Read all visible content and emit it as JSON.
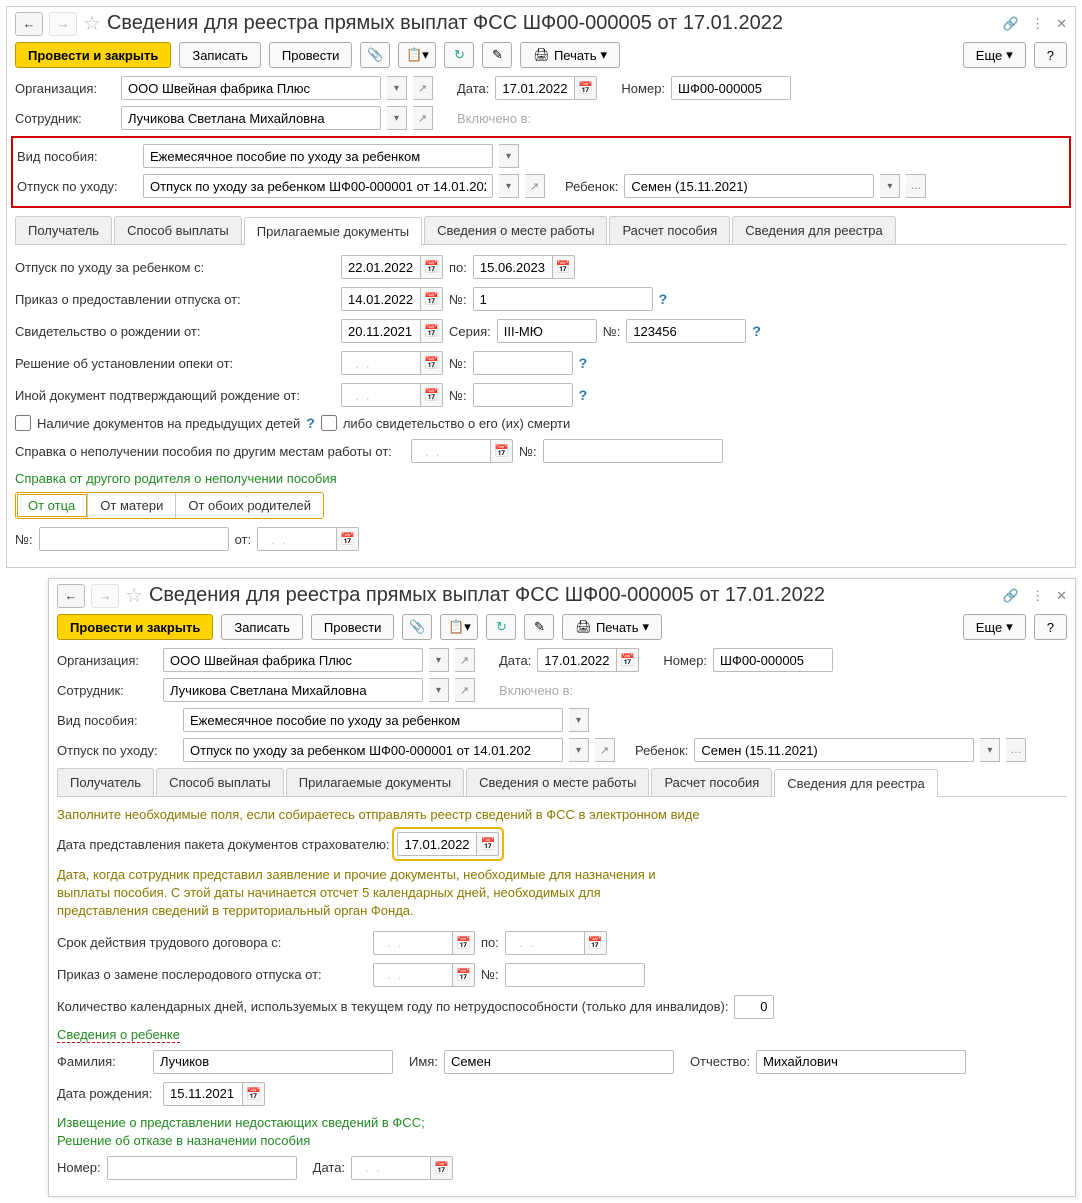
{
  "win1": {
    "title": "Сведения для реестра прямых выплат ФСС ШФ00-000005 от 17.01.2022",
    "toolbar": {
      "submit": "Провести и закрыть",
      "write": "Записать",
      "post": "Провести",
      "print": "Печать",
      "more": "Еще",
      "help": "?"
    },
    "org": {
      "label": "Организация:",
      "value": "ООО Швейная фабрика Плюс"
    },
    "date": {
      "label": "Дата:",
      "value": "17.01.2022"
    },
    "number": {
      "label": "Номер:",
      "value": "ШФ00-000005"
    },
    "emp": {
      "label": "Сотрудник:",
      "value": "Лучикова Светлана Михайловна"
    },
    "included": {
      "label": "Включено в:"
    },
    "benefit": {
      "label": "Вид пособия:",
      "value": "Ежемесячное пособие по уходу за ребенком"
    },
    "leave": {
      "label": "Отпуск по уходу:",
      "value": "Отпуск по уходу за ребенком ШФ00-000001 от 14.01.202"
    },
    "child": {
      "label": "Ребенок:",
      "value": "Семен (15.11.2021)"
    },
    "tabs": [
      "Получатель",
      "Способ выплаты",
      "Прилагаемые документы",
      "Сведения о месте работы",
      "Расчет пособия",
      "Сведения для реестра"
    ],
    "f": {
      "leaveFrom": {
        "label": "Отпуск по уходу за ребенком с:",
        "v1": "22.01.2022",
        "to": "по:",
        "v2": "15.06.2023"
      },
      "order": {
        "label": "Приказ о предоставлении отпуска от:",
        "date": "14.01.2022",
        "no": "№:",
        "nov": "1"
      },
      "birth": {
        "label": "Свидетельство о рождении от:",
        "date": "20.11.2021",
        "series": "Серия:",
        "sv": "III-МЮ",
        "no": "№:",
        "nov": "123456"
      },
      "guard": {
        "label": "Решение об установлении опеки от:",
        "date": "  .  .    ",
        "no": "№:"
      },
      "other": {
        "label": "Иной документ подтверждающий рождение от:",
        "date": "  .  .    ",
        "no": "№:"
      },
      "prev": {
        "label": "Наличие документов на предыдущих детей",
        "death": "либо свидетельство о его (их) смерти"
      },
      "spravka": {
        "label": "Справка о неполучении пособия по другим местам работы от:",
        "date": "  .  .    ",
        "no": "№:"
      },
      "parent": {
        "title": "Справка от другого родителя о неполучении пособия",
        "opts": [
          "От отца",
          "От матери",
          "От обоих родителей"
        ]
      },
      "bottom": {
        "no": "№:",
        "from": "от:",
        "date": "  .  .    "
      }
    }
  },
  "win2": {
    "title": "Сведения для реестра прямых выплат ФСС ШФ00-000005 от 17.01.2022",
    "toolbar": {
      "submit": "Провести и закрыть",
      "write": "Записать",
      "post": "Провести",
      "print": "Печать",
      "more": "Еще",
      "help": "?"
    },
    "org": {
      "label": "Организация:",
      "value": "ООО Швейная фабрика Плюс"
    },
    "date": {
      "label": "Дата:",
      "value": "17.01.2022"
    },
    "number": {
      "label": "Номер:",
      "value": "ШФ00-000005"
    },
    "emp": {
      "label": "Сотрудник:",
      "value": "Лучикова Светлана Михайловна"
    },
    "included": {
      "label": "Включено в:"
    },
    "benefit": {
      "label": "Вид пособия:",
      "value": "Ежемесячное пособие по уходу за ребенком"
    },
    "leave": {
      "label": "Отпуск по уходу:",
      "value": "Отпуск по уходу за ребенком ШФ00-000001 от 14.01.202"
    },
    "child": {
      "label": "Ребенок:",
      "value": "Семен (15.11.2021)"
    },
    "tabs": [
      "Получатель",
      "Способ выплаты",
      "Прилагаемые документы",
      "Сведения о месте работы",
      "Расчет пособия",
      "Сведения для реестра"
    ],
    "hint1": "Заполните необходимые поля, если собираетесь отправлять реестр сведений в ФСС в электронном виде",
    "pkg": {
      "label": "Дата представления пакета документов страхователю:",
      "value": "17.01.2022"
    },
    "hint2": "Дата, когда сотрудник представил заявление и прочие документы, необходимые для назначения и выплаты пособия. С этой даты начинается отсчет 5 календарных дней, необходимых для представления сведений в территориальный орган Фонда.",
    "contract": {
      "label": "Срок действия трудового договора с:",
      "d1": "  .  .    ",
      "to": "по:",
      "d2": "  .  .    "
    },
    "replace": {
      "label": "Приказ о замене послеродового отпуска от:",
      "date": "  .  .    ",
      "no": "№:"
    },
    "days": {
      "label": "Количество календарных дней, используемых в текущем году по нетрудоспособности (только для инвалидов):",
      "value": "0"
    },
    "childTitle": "Сведения о ребенке",
    "fam": {
      "label": "Фамилия:",
      "value": "Лучиков"
    },
    "name": {
      "label": "Имя:",
      "value": "Семен"
    },
    "patr": {
      "label": "Отчество:",
      "value": "Михайлович"
    },
    "birth": {
      "label": "Дата рождения:",
      "value": "15.11.2021"
    },
    "notice": "Извещение о представлении недостающих сведений в ФСС;\nРешение об отказе в назначении пособия",
    "num": {
      "label": "Номер:",
      "date": "Дата:",
      "dv": "  .  .    "
    }
  }
}
